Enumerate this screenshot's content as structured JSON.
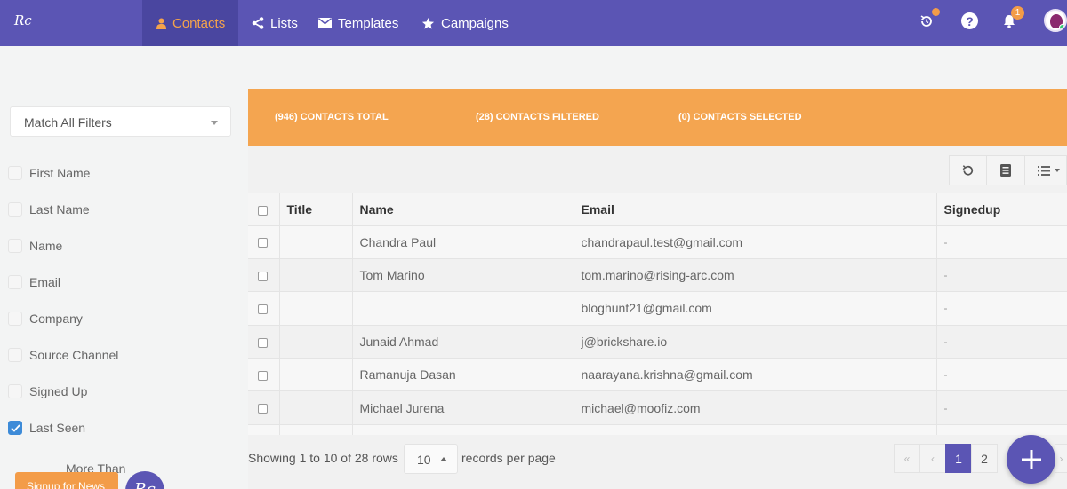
{
  "brand": {
    "logo": "Rc",
    "accent": "#5b55b4",
    "orange": "#f4a550",
    "check_blue": "#3d8bd8"
  },
  "nav": {
    "items": [
      {
        "label": "Contacts",
        "icon": "user-icon",
        "active": true
      },
      {
        "label": "Lists",
        "icon": "share-icon",
        "active": false
      },
      {
        "label": "Templates",
        "icon": "envelope-icon",
        "active": false
      },
      {
        "label": "Campaigns",
        "icon": "star-icon",
        "active": false
      }
    ],
    "notification_count": "1"
  },
  "sidebar": {
    "match_filter": "Match All Filters",
    "filters": [
      {
        "label": "First Name",
        "checked": false
      },
      {
        "label": "Last Name",
        "checked": false
      },
      {
        "label": "Name",
        "checked": false
      },
      {
        "label": "Email",
        "checked": false
      },
      {
        "label": "Company",
        "checked": false
      },
      {
        "label": "Source Channel",
        "checked": false
      },
      {
        "label": "Signed Up",
        "checked": false
      },
      {
        "label": "Last Seen",
        "checked": true
      }
    ],
    "last_seen_option": "More Than",
    "news_button": "Signup for News"
  },
  "stats": {
    "total": "(946) CONTACTS TOTAL",
    "filtered": "(28) CONTACTS FILTERED",
    "selected": "(0) CONTACTS SELECTED"
  },
  "table": {
    "columns": [
      "Title",
      "Name",
      "Email",
      "Signedup"
    ],
    "rows": [
      {
        "title": "",
        "name": "Chandra Paul",
        "email": "chandrapaul.test@gmail.com",
        "signedup": "-"
      },
      {
        "title": "",
        "name": "Tom Marino",
        "email": "tom.marino@rising-arc.com",
        "signedup": "-"
      },
      {
        "title": "",
        "name": "",
        "email": "bloghunt21@gmail.com",
        "signedup": "-"
      },
      {
        "title": "",
        "name": "Junaid Ahmad",
        "email": "j@brickshare.io",
        "signedup": "-"
      },
      {
        "title": "",
        "name": "Ramanuja Dasan",
        "email": "naarayana.krishna@gmail.com",
        "signedup": "-"
      },
      {
        "title": "",
        "name": "Michael Jurena",
        "email": "michael@moofiz.com",
        "signedup": "-"
      }
    ]
  },
  "footer": {
    "showing": "Showing 1 to 10 of 28 rows",
    "per_page_value": "10",
    "per_page_label": "records per page",
    "pages": [
      "1",
      "2"
    ],
    "first": "«",
    "prev": "‹",
    "next": "›"
  }
}
